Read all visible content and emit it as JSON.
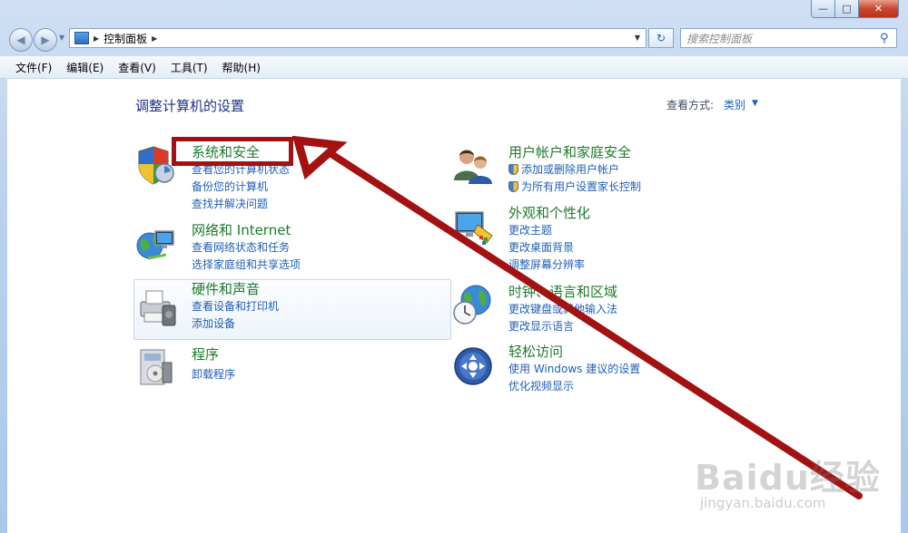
{
  "window": {
    "caption_buttons": {
      "minimize": "—",
      "maximize": "□",
      "close": "✕"
    }
  },
  "navbar": {
    "back_glyph": "◀",
    "forward_glyph": "▶",
    "breadcrumb": [
      "控制面板"
    ],
    "refresh_glyph": "↻",
    "search_placeholder": "搜索控制面板"
  },
  "menubar": {
    "items": [
      "文件(F)",
      "编辑(E)",
      "查看(V)",
      "工具(T)",
      "帮助(H)"
    ]
  },
  "main": {
    "title": "调整计算机的设置",
    "view_label": "查看方式:",
    "view_value": "类别",
    "categories": [
      {
        "title": "系统和安全",
        "icon": "shield-icon",
        "links": [
          "查看您的计算机状态",
          "备份您的计算机",
          "查找并解决问题"
        ]
      },
      {
        "title": "网络和 Internet",
        "icon": "network-globe-icon",
        "links": [
          "查看网络状态和任务",
          "选择家庭组和共享选项"
        ]
      },
      {
        "title": "硬件和声音",
        "icon": "printer-icon",
        "links": [
          "查看设备和打印机",
          "添加设备"
        ]
      },
      {
        "title": "程序",
        "icon": "programs-icon",
        "links": [
          "卸载程序"
        ]
      },
      {
        "title": "用户帐户和家庭安全",
        "icon": "users-icon",
        "links": [
          "添加或删除用户帐户",
          "为所有用户设置家长控制"
        ]
      },
      {
        "title": "外观和个性化",
        "icon": "monitor-paint-icon",
        "links": [
          "更改主题",
          "更改桌面背景",
          "调整屏幕分辨率"
        ]
      },
      {
        "title": "时钟、语言和区域",
        "icon": "clock-globe-icon",
        "links": [
          "更改键盘或其他输入法",
          "更改显示语言"
        ]
      },
      {
        "title": "轻松访问",
        "icon": "ease-of-access-icon",
        "links": [
          "使用 Windows 建议的设置",
          "优化视频显示"
        ]
      }
    ]
  },
  "watermark": {
    "logo": "Baidu经验",
    "url": "jingyan.baidu.com"
  },
  "colors": {
    "accent_link": "#1f5fb8",
    "category_title": "#1d7a2c",
    "annotation": "#a31212"
  }
}
